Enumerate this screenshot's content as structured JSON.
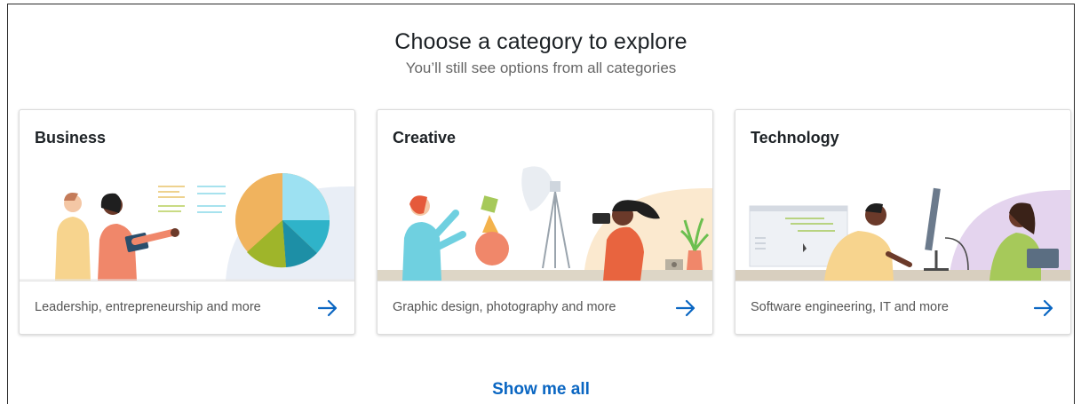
{
  "header": {
    "title": "Choose a category to explore",
    "subtitle": "You’ll still see options from all categories"
  },
  "categories": [
    {
      "title": "Business",
      "description": "Leadership, entrepreneurship and more",
      "icon": "arrow-right-icon"
    },
    {
      "title": "Creative",
      "description": "Graphic design, photography and more",
      "icon": "arrow-right-icon"
    },
    {
      "title": "Technology",
      "description": "Software engineering, IT and more",
      "icon": "arrow-right-icon"
    }
  ],
  "footer": {
    "show_all_label": "Show me all"
  },
  "colors": {
    "accent": "#0a66c2",
    "arrow": "#0a66c2"
  }
}
